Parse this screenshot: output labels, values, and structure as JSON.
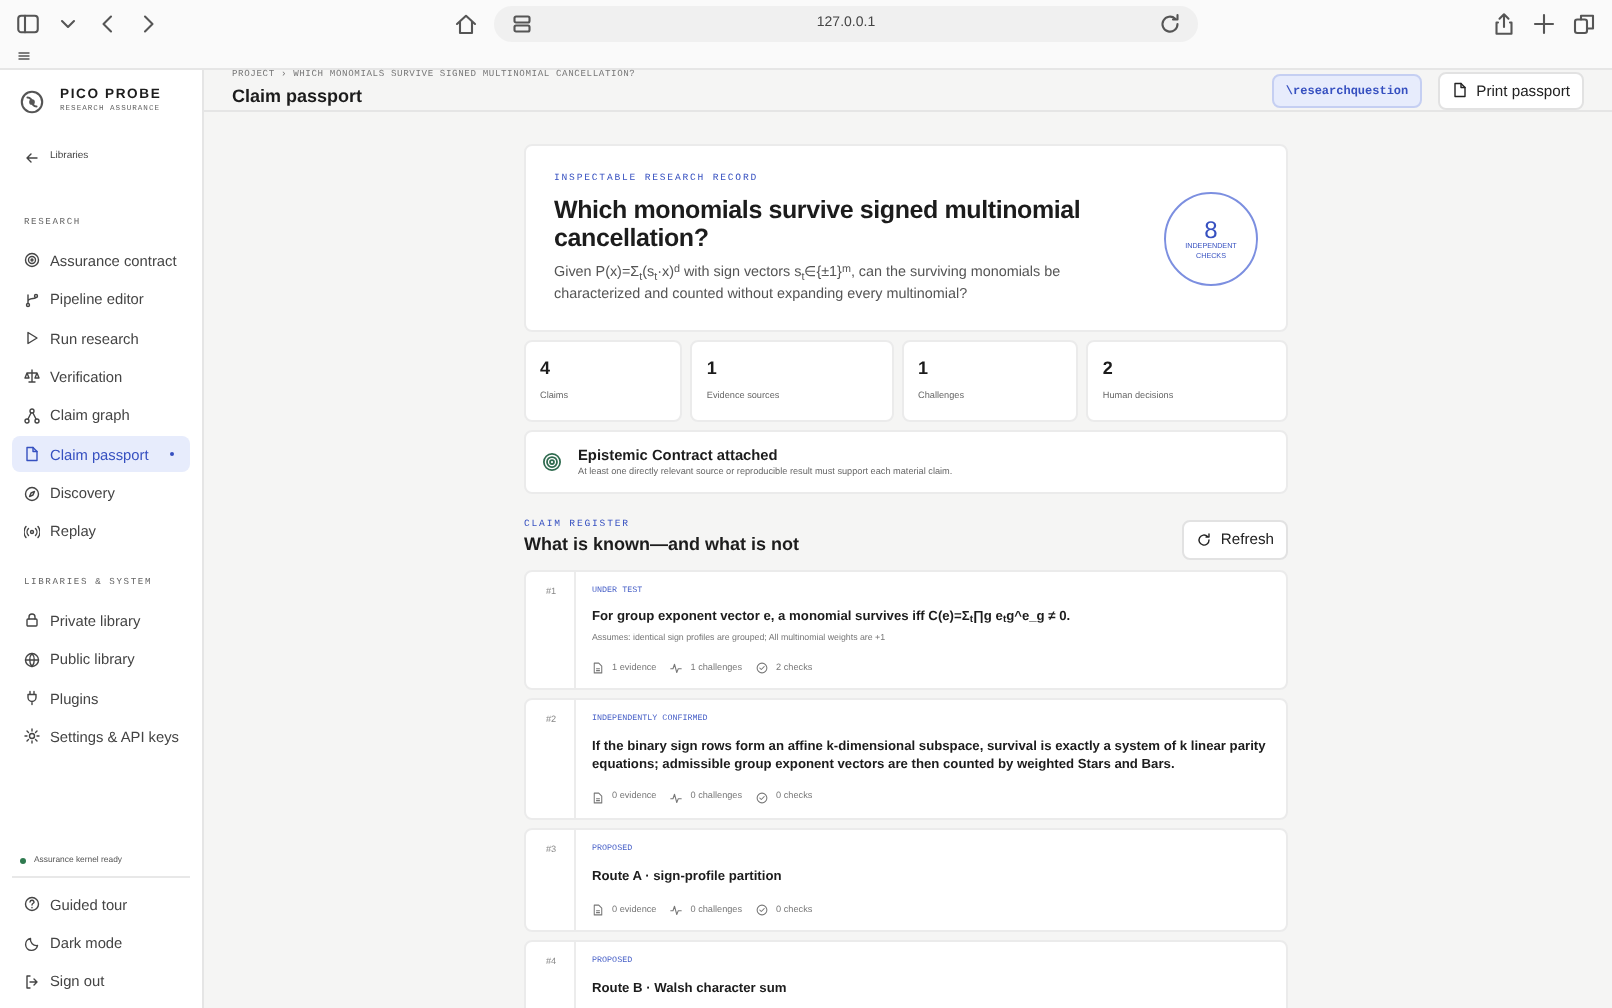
{
  "browser": {
    "address": "127.0.0.1"
  },
  "brand": {
    "name": "PICO PROBE",
    "tagline": "RESEARCH ASSURANCE"
  },
  "back_link": "Libraries",
  "sidebar": {
    "sections": [
      {
        "title": "RESEARCH",
        "items": [
          {
            "label": "Assurance contract",
            "selected": false
          },
          {
            "label": "Pipeline editor",
            "selected": false
          },
          {
            "label": "Run research",
            "selected": false
          },
          {
            "label": "Verification",
            "selected": false
          },
          {
            "label": "Claim graph",
            "selected": false
          },
          {
            "label": "Claim passport",
            "selected": true
          },
          {
            "label": "Discovery",
            "selected": false
          },
          {
            "label": "Replay",
            "selected": false
          }
        ]
      },
      {
        "title": "LIBRARIES & SYSTEM",
        "items": [
          {
            "label": "Private library",
            "selected": false
          },
          {
            "label": "Public library",
            "selected": false
          },
          {
            "label": "Plugins",
            "selected": false
          },
          {
            "label": "Settings & API keys",
            "selected": false
          }
        ]
      }
    ],
    "status": "Assurance kernel ready",
    "footer": [
      "Guided tour",
      "Dark mode",
      "Sign out"
    ]
  },
  "header": {
    "breadcrumb": "PROJECT › WHICH MONOMIALS SURVIVE SIGNED MULTINOMIAL CANCELLATION?",
    "title": "Claim passport",
    "tag_button": "\\researchquestion",
    "print_button": "Print passport"
  },
  "record": {
    "eyebrow": "INSPECTABLE RESEARCH RECORD",
    "title": "Which monomials survive signed multinomial cancellation?",
    "question": "Given P(x)=Σ$_{t}$(s$_{t}$·x)$^{d}$ with sign vectors s$_{t}$∈{±1}$^{m}$, can the surviving monomials be characterized and counted without expanding every multinomial?",
    "checks_count": "8",
    "checks_label": "INDEPENDENT CHECKS"
  },
  "stats": [
    {
      "value": "4",
      "label": "Claims"
    },
    {
      "value": "1",
      "label": "Evidence sources"
    },
    {
      "value": "1",
      "label": "Challenges"
    },
    {
      "value": "2",
      "label": "Human decisions"
    }
  ],
  "contract": {
    "title": "Epistemic Contract attached",
    "text": "At least one directly relevant source or reproducible result must support each material claim."
  },
  "register": {
    "eyebrow": "CLAIM REGISTER",
    "title": "What is known—and what is not",
    "refresh": "Refresh"
  },
  "claims": [
    {
      "number": "#1",
      "status": "UNDER TEST",
      "title": "For group exponent vector e, a monomial survives iff C(e)=Σ$_{t}$∏g e$_{t}$g^e_g ≠ 0.",
      "assumptions": "Assumes: identical sign profiles are grouped; All multinomial weights are +1",
      "evidence": "1 evidence",
      "challenges": "1 challenges",
      "checks": "2 checks"
    },
    {
      "number": "#2",
      "status": "INDEPENDENTLY CONFIRMED",
      "title": "If the binary sign rows form an affine k-dimensional subspace, survival is exactly a system of k linear parity equations; admissible group exponent vectors are then counted by weighted Stars and Bars.",
      "evidence": "0 evidence",
      "challenges": "0 challenges",
      "checks": "0 checks"
    },
    {
      "number": "#3",
      "status": "PROPOSED",
      "title": "Route A · sign-profile partition",
      "evidence": "0 evidence",
      "challenges": "0 challenges",
      "checks": "0 checks"
    },
    {
      "number": "#4",
      "status": "PROPOSED",
      "title": "Route B · Walsh character sum"
    }
  ]
}
